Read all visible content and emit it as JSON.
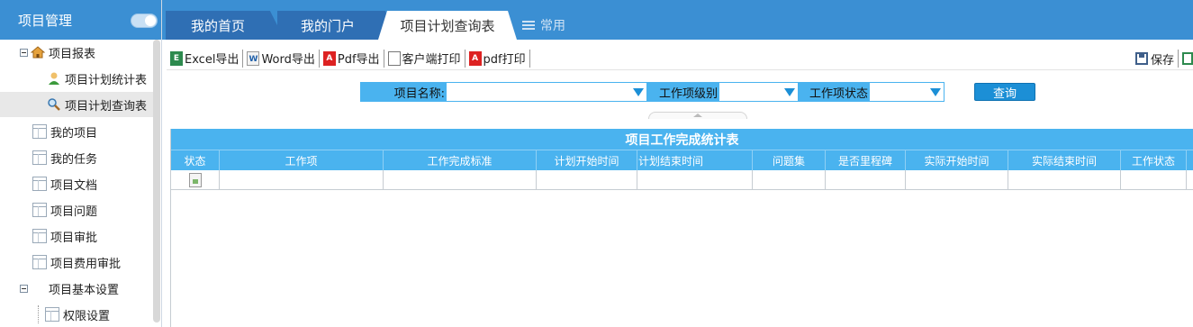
{
  "sidebar": {
    "title": "项目管理",
    "items": [
      {
        "label": "项目报表"
      },
      {
        "label": "项目计划统计表"
      },
      {
        "label": "项目计划查询表"
      },
      {
        "label": "我的项目"
      },
      {
        "label": "我的任务"
      },
      {
        "label": "项目文档"
      },
      {
        "label": "项目问题"
      },
      {
        "label": "项目审批"
      },
      {
        "label": "项目费用审批"
      },
      {
        "label": "项目基本设置"
      },
      {
        "label": "权限设置"
      }
    ]
  },
  "tabs": [
    {
      "label": "我的首页"
    },
    {
      "label": "我的门户"
    },
    {
      "label": "项目计划查询表"
    },
    {
      "label": "常用"
    }
  ],
  "toolbar": {
    "buttons": [
      {
        "label": "Excel导出",
        "icon": "excel-icon"
      },
      {
        "label": "Word导出",
        "icon": "word-icon"
      },
      {
        "label": "Pdf导出",
        "icon": "pdf-icon"
      },
      {
        "label": "客户端打印",
        "icon": "print-icon"
      },
      {
        "label": "pdf打印",
        "icon": "pdf-icon"
      }
    ],
    "save_label": "保存"
  },
  "query": {
    "project_name_label": "项目名称:",
    "project_name_value": "",
    "level_label": "工作项级别",
    "level_value": "",
    "status_label": "工作项状态",
    "status_value": "",
    "button_label": "查询"
  },
  "table": {
    "title": "项目工作完成统计表",
    "columns": [
      "状态",
      "工作项",
      "工作完成标准",
      "计划开始时间",
      "计划结束时间",
      "问题集",
      "是否里程碑",
      "实际开始时间",
      "实际结束时间",
      "工作状态"
    ]
  },
  "colors": {
    "header_blue": "#3b8fd3",
    "tab_dark": "#2f6fb4",
    "grid_blue": "#4ab3ef",
    "button_blue": "#1c8fd6"
  }
}
